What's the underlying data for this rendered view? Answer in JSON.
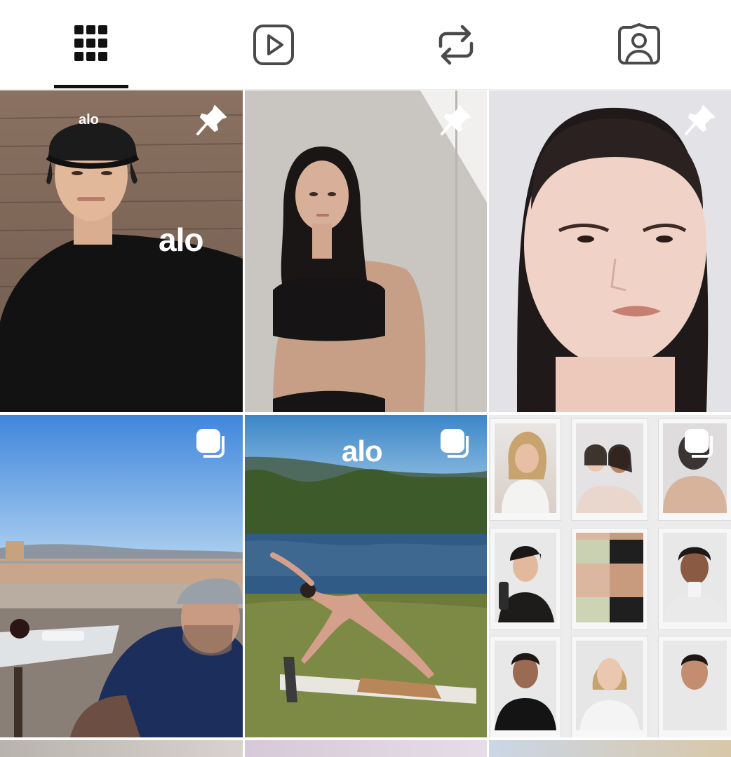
{
  "tabs": [
    {
      "id": "grid",
      "icon": "grid-icon",
      "selected": true
    },
    {
      "id": "reels",
      "icon": "reels-play-icon",
      "selected": false
    },
    {
      "id": "reposts",
      "icon": "repost-icon",
      "selected": false
    },
    {
      "id": "tagged",
      "icon": "tagged-person-icon",
      "selected": false
    }
  ],
  "posts": [
    {
      "badge": "pin-icon",
      "overlay_text": "alo"
    },
    {
      "badge": "pin-icon"
    },
    {
      "badge": "pin-icon"
    },
    {
      "badge": "carousel-icon"
    },
    {
      "badge": "carousel-icon",
      "overlay_text": "alo"
    },
    {
      "badge": "carousel-icon"
    }
  ],
  "colors": {
    "accent": "#111111",
    "icon": "#4a4a4a"
  }
}
